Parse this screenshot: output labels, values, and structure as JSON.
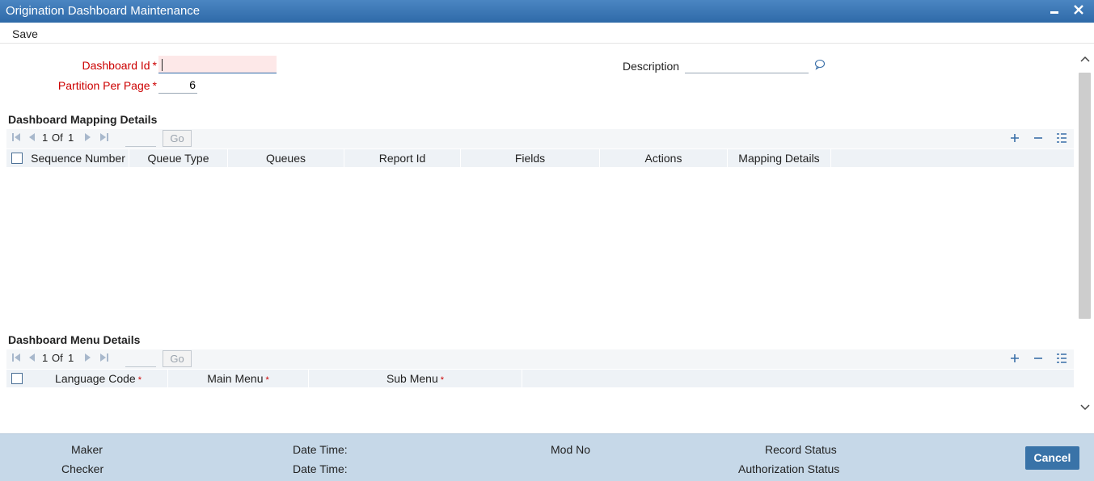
{
  "window": {
    "title": "Origination Dashboard Maintenance",
    "minimize_glyph": "▬",
    "close_glyph": "✕"
  },
  "menu": {
    "save_label": "Save"
  },
  "form": {
    "dashboard_id": {
      "label": "Dashboard Id",
      "required_mark": "*",
      "value": ""
    },
    "partition_per_page": {
      "label": "Partition Per Page",
      "required_mark": "*",
      "value": "6"
    },
    "description": {
      "label": "Description",
      "value": "",
      "icon": "comment-icon"
    }
  },
  "mapping": {
    "title": "Dashboard Mapping Details",
    "pager": {
      "current": "1",
      "of_label": "Of",
      "total": "1",
      "go_label": "Go"
    },
    "columns": [
      "Sequence Number",
      "Queue Type",
      "Queues",
      "Report Id",
      "Fields",
      "Actions",
      "Mapping Details"
    ],
    "rows": []
  },
  "menu_details": {
    "title": "Dashboard Menu Details",
    "pager": {
      "current": "1",
      "of_label": "Of",
      "total": "1",
      "go_label": "Go"
    },
    "columns": [
      "Language Code",
      "Main Menu",
      "Sub Menu"
    ],
    "required_mark": "*",
    "rows": []
  },
  "footer": {
    "maker_label": "Maker",
    "checker_label": "Checker",
    "maker_datetime_label": "Date Time:",
    "checker_datetime_label": "Date Time:",
    "mod_no_label": "Mod No",
    "record_status_label": "Record Status",
    "authorization_status_label": "Authorization Status",
    "cancel_label": "Cancel"
  },
  "icons": {
    "first_page": "⏮",
    "prev_page": "◀",
    "next_page": "▶",
    "last_page": "⏭",
    "add": "+",
    "delete": "−",
    "single_view": "☷"
  }
}
